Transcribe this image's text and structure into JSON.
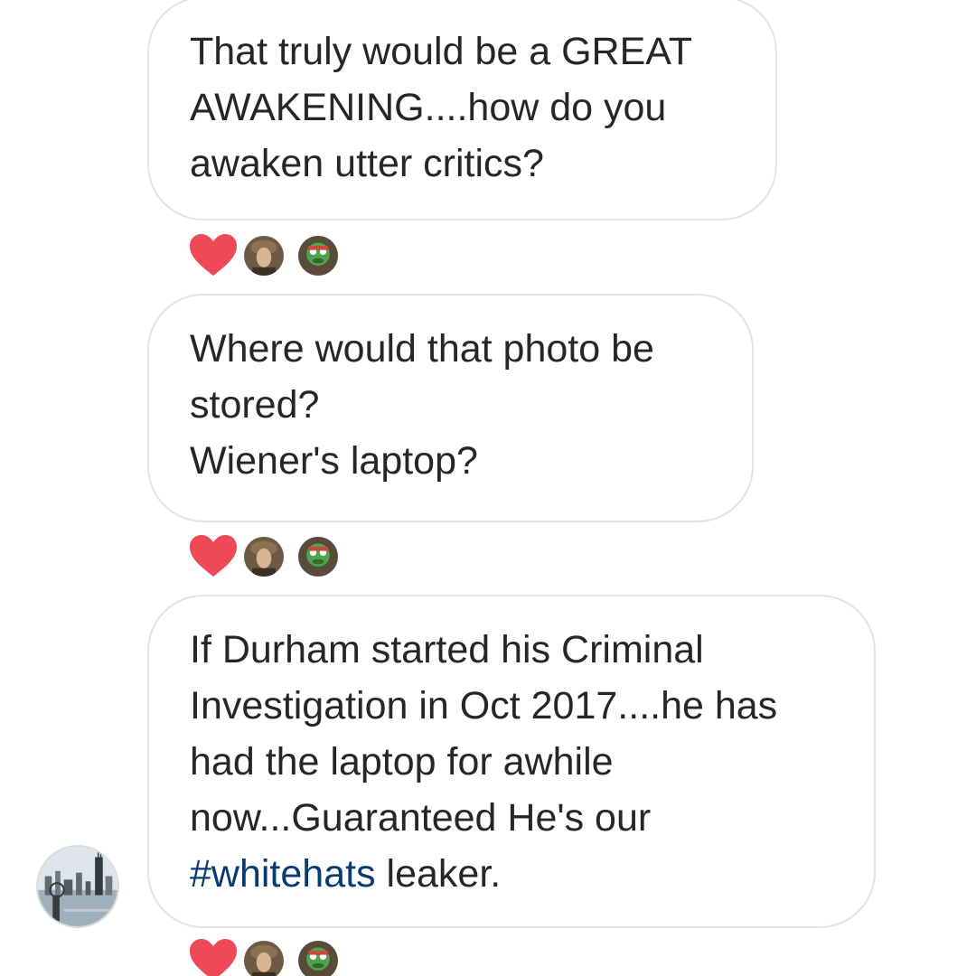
{
  "messages": [
    {
      "lines": [
        "That truly would be a GREAT",
        "AWAKENING....how do you",
        "awaken utter critics?"
      ],
      "reactions": [
        "heart-icon",
        "user-avatar-1",
        "user-avatar-2"
      ]
    },
    {
      "lines": [
        "Where would that photo be",
        "stored?",
        "Wiener's laptop?"
      ],
      "reactions": [
        "heart-icon",
        "user-avatar-1",
        "user-avatar-2"
      ]
    },
    {
      "lines": [
        "If Durham started his Criminal",
        "Investigation in Oct 2017....he has",
        "had the laptop for awhile",
        "now...Guaranteed He's our"
      ],
      "last_line": {
        "hashtag": "#whitehats",
        "text": " leaker."
      },
      "reactions": [
        "heart-icon",
        "user-avatar-1",
        "user-avatar-2"
      ]
    }
  ],
  "colors": {
    "heart": "#ed4956",
    "hashtag": "#0a3a73",
    "bubble_border": "#e3e3e3",
    "text": "#262626"
  }
}
